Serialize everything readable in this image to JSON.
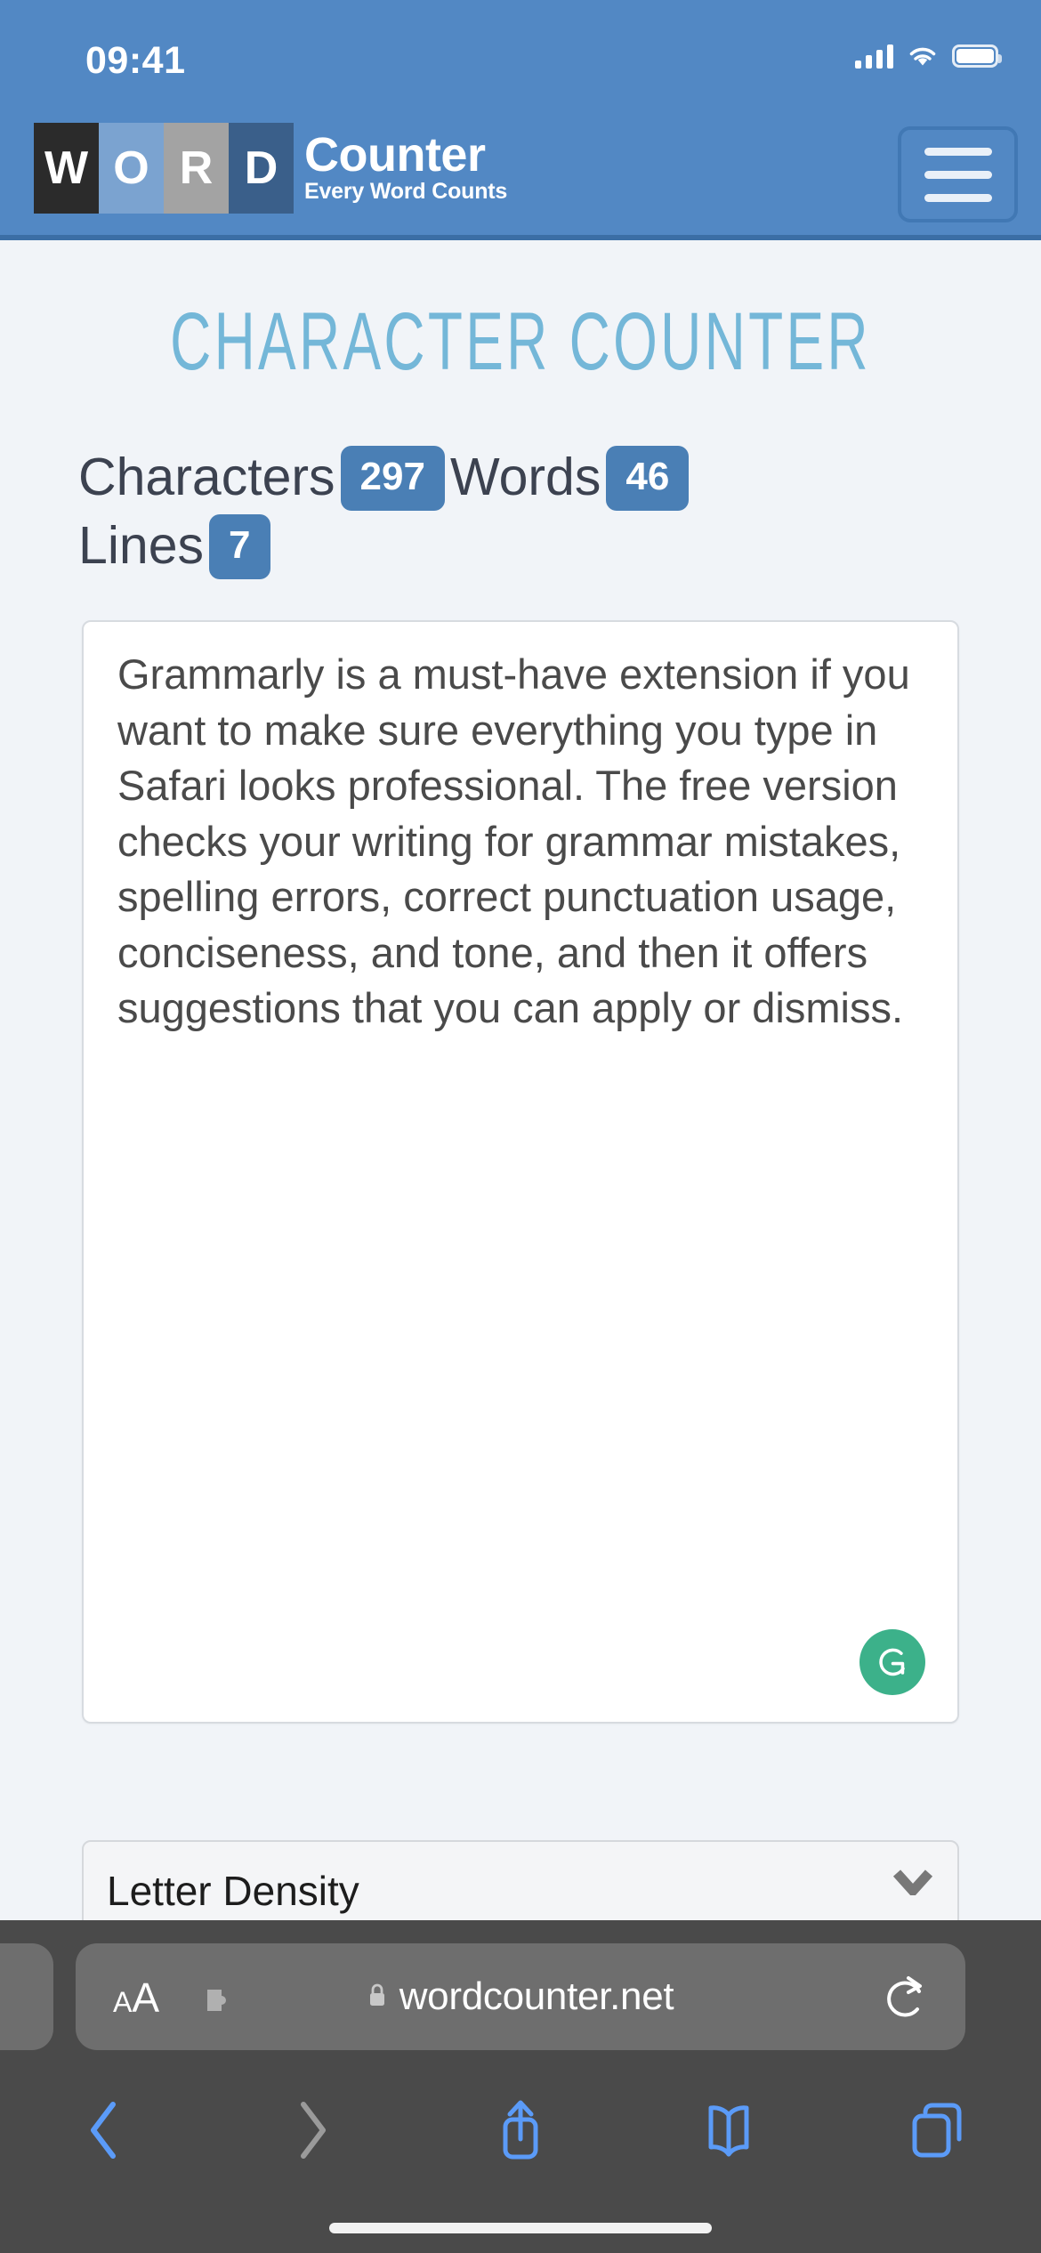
{
  "status_bar": {
    "time": "09:41",
    "icons": [
      "cellular-signal-icon",
      "wifi-icon",
      "battery-icon"
    ]
  },
  "site_header": {
    "logo_tiles": [
      "W",
      "O",
      "R",
      "D"
    ],
    "brand_primary": "Counter",
    "brand_tagline": "Every Word Counts",
    "menu_icon": "hamburger-menu-icon",
    "background_color": "#5288c4"
  },
  "main": {
    "page_title": "CHARACTER COUNTER",
    "title_color": "#74b7d8",
    "counters": [
      {
        "label": "Characters",
        "value": "297"
      },
      {
        "label": "Words",
        "value": "46"
      },
      {
        "label": "Lines",
        "value": "7"
      }
    ],
    "badge_color": "#4a7fb5",
    "textarea": {
      "value": "Grammarly is a must-have extension if you want to make sure everything you type in Safari looks professional. The free version checks your writing for grammar mistakes, spelling errors, correct punctuation usage, conciseness, and tone, and then it offers suggestions that you can apply or dismiss.",
      "grammarly_icon": "grammarly-logo-icon",
      "grammarly_color": "#3cb18a"
    },
    "letter_density": {
      "label": "Letter Density",
      "chevron_icon": "chevron-down-icon"
    }
  },
  "browser": {
    "url": "wordcounter.net",
    "lock_icon": "lock-icon",
    "text_size_label_small": "A",
    "text_size_label_large": "A",
    "extensions_icon": "puzzle-piece-icon",
    "reload_icon": "reload-icon",
    "toolbar": [
      {
        "name": "back-button",
        "icon": "chevron-left-icon",
        "enabled": true
      },
      {
        "name": "forward-button",
        "icon": "chevron-right-icon",
        "enabled": false
      },
      {
        "name": "share-button",
        "icon": "share-icon",
        "enabled": true
      },
      {
        "name": "bookmarks-button",
        "icon": "book-icon",
        "enabled": true
      },
      {
        "name": "tabs-button",
        "icon": "tabs-icon",
        "enabled": true
      }
    ],
    "accent_color": "#5b9bf8"
  }
}
